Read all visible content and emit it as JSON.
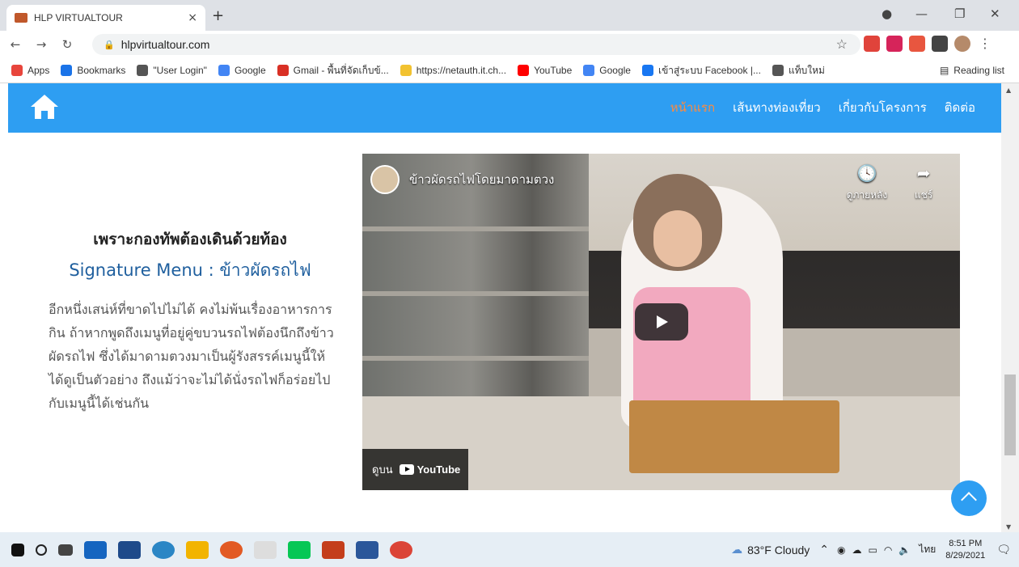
{
  "browser": {
    "tab_title": "HLP VIRTUALTOUR",
    "tab_close": "×",
    "new_tab": "+",
    "url": "hlpvirtualtour.com",
    "bookmarks": [
      {
        "label": "Apps",
        "icon": "apps-grid-icon",
        "color": "#e8453c"
      },
      {
        "label": "Bookmarks",
        "icon": "star-icon",
        "color": "#1a73e8"
      },
      {
        "label": "\"User Login\"",
        "icon": "globe-icon",
        "color": "#555555"
      },
      {
        "label": "Google",
        "icon": "google-icon",
        "color": "#4285f4"
      },
      {
        "label": "Gmail - พื้นที่จัดเก็บข้...",
        "icon": "gmail-icon",
        "color": "#d93025"
      },
      {
        "label": "https://netauth.it.ch...",
        "icon": "folder-icon",
        "color": "#f2c230"
      },
      {
        "label": "YouTube",
        "icon": "youtube-icon",
        "color": "#ff0000"
      },
      {
        "label": "Google",
        "icon": "google-icon",
        "color": "#4285f4"
      },
      {
        "label": "เข้าสู่ระบบ Facebook |...",
        "icon": "facebook-icon",
        "color": "#1877f2"
      },
      {
        "label": "แท็บใหม่",
        "icon": "globe-icon",
        "color": "#555555"
      }
    ],
    "reading_list": "Reading list"
  },
  "site": {
    "nav": [
      {
        "label": "หน้าแรก",
        "active": true
      },
      {
        "label": "เส้นทางท่องเที่ยว",
        "active": false
      },
      {
        "label": "เกี่ยวกับโครงการ",
        "active": false
      },
      {
        "label": "ติดต่อ",
        "active": false
      }
    ],
    "heading": "เพราะกองทัพต้องเดินด้วยท้อง",
    "subheading": "Signature Menu : ข้าวผัดรถไฟ",
    "paragraph": "อีกหนึ่งเสน่ห์ที่ขาดไปไม่ได้ คงไม่พ้นเรื่องอาหารการกิน ถ้าหากพูดถึงเมนูที่อยู่คู่ขบวนรถไฟต้องนึกถึงข้าวผัดรถไฟ ซึ่งได้มาดามตวงมาเป็นผู้รังสรรค์เมนูนี้ให้ได้ดูเป็นตัวอย่าง ถึงแม้ว่าจะไม่ได้นั่งรถไฟก็อร่อยไปกับเมนูนี้ได้เช่นกัน",
    "video": {
      "title": "ข้าวผัดรถไฟโดยมาดามตวง",
      "watch_later": "ดูภายหลัง",
      "share": "แชร์",
      "watch_on": "ดูบน",
      "youtube": "YouTube"
    }
  },
  "taskbar": {
    "weather": "83°F  Cloudy",
    "language": "ไทย",
    "time": "8:51 PM",
    "date": "8/29/2021"
  },
  "colors": {
    "nav_bg": "#2e9ef2",
    "nav_active": "#ff8a3d",
    "subheading": "#1f5f9e"
  }
}
